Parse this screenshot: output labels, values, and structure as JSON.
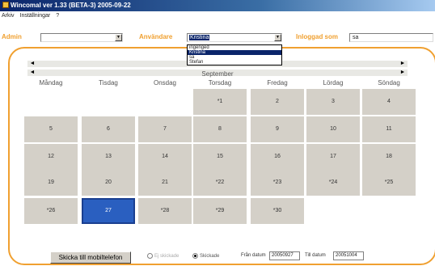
{
  "window": {
    "title": "Wincomal ver 1.33 (BETA-3) 2005-09-22"
  },
  "menu": {
    "items": [
      "Arkiv",
      "Inställningar",
      "?"
    ]
  },
  "filters": {
    "admin_label": "Admin",
    "admin_value": "",
    "user_label": "Användare",
    "user_value": "Kristina",
    "logged_in_label": "Inloggad som",
    "logged_in_value": "sa",
    "user_options": [
      "ingenged",
      "Kristina",
      "sa",
      "Stefan"
    ],
    "user_selected_index": 1
  },
  "calendar": {
    "month": "September",
    "nav_prev": "◄",
    "nav_next": "►",
    "weekdays": [
      "Måndag",
      "Tisdag",
      "Onsdag",
      "Torsdag",
      "Fredag",
      "Lördag",
      "Söndag"
    ],
    "weeks": [
      [
        "",
        "",
        "",
        "*1",
        "2",
        "3",
        "4"
      ],
      [
        "5",
        "6",
        "7",
        "8",
        "9",
        "10",
        "11"
      ],
      [
        "12",
        "13",
        "14",
        "15",
        "16",
        "17",
        "18"
      ],
      [
        "19",
        "20",
        "21",
        "*22",
        "*23",
        "*24",
        "*25"
      ],
      [
        "*26",
        "27",
        "*28",
        "*29",
        "*30",
        "",
        ""
      ]
    ],
    "selected_day": "27"
  },
  "footer": {
    "send_button": "Skicka till mobiltelefon",
    "radio_unsent": "Ej skickade",
    "radio_sent": "Skickade",
    "radio_selected": "sent",
    "from_label": "Från datum",
    "from_value": "20050927",
    "to_label": "Till datum",
    "to_value": "20051004"
  }
}
